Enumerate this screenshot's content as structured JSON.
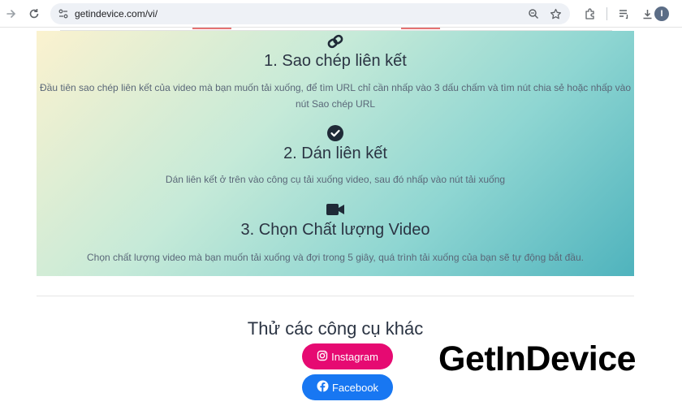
{
  "browser": {
    "url": "getindevice.com/vi/",
    "avatar_letter": "I",
    "icons": [
      "forward-icon",
      "reload-icon",
      "site-settings-icon",
      "zoom-icon",
      "bookmark-star-icon",
      "extensions-icon",
      "reading-list-icon",
      "download-icon",
      "menu-icon"
    ]
  },
  "steps": [
    {
      "icon": "link-icon",
      "title": "1. Sao chép liên kết",
      "text": "Đầu tiên sao chép liên kết của video mà bạn muốn tải xuống, để tìm URL chỉ cần nhấp vào 3 dấu chấm và tìm nút chia sẻ hoặc nhấp vào nút Sao chép URL"
    },
    {
      "icon": "check-circle-icon",
      "title": "2. Dán liên kết",
      "text": "Dán liên kết ở trên vào công cụ tải xuống video, sau đó nhấp vào nút tải xuống"
    },
    {
      "icon": "video-camera-icon",
      "title": "3. Chọn Chất lượng Video",
      "text": "Chọn chất lượng video mà bạn muốn tải xuống và đợi trong 5 giây, quá trình tải xuống của bạn sẽ tự động bắt đầu."
    }
  ],
  "other_tools": {
    "title": "Thử các công cụ khác",
    "buttons": [
      {
        "label": "Instagram",
        "icon": "instagram-icon",
        "color": "#e60a72"
      },
      {
        "label": "Facebook",
        "icon": "facebook-icon",
        "color": "#1877f2"
      }
    ]
  },
  "watermark": "GetInDevice"
}
